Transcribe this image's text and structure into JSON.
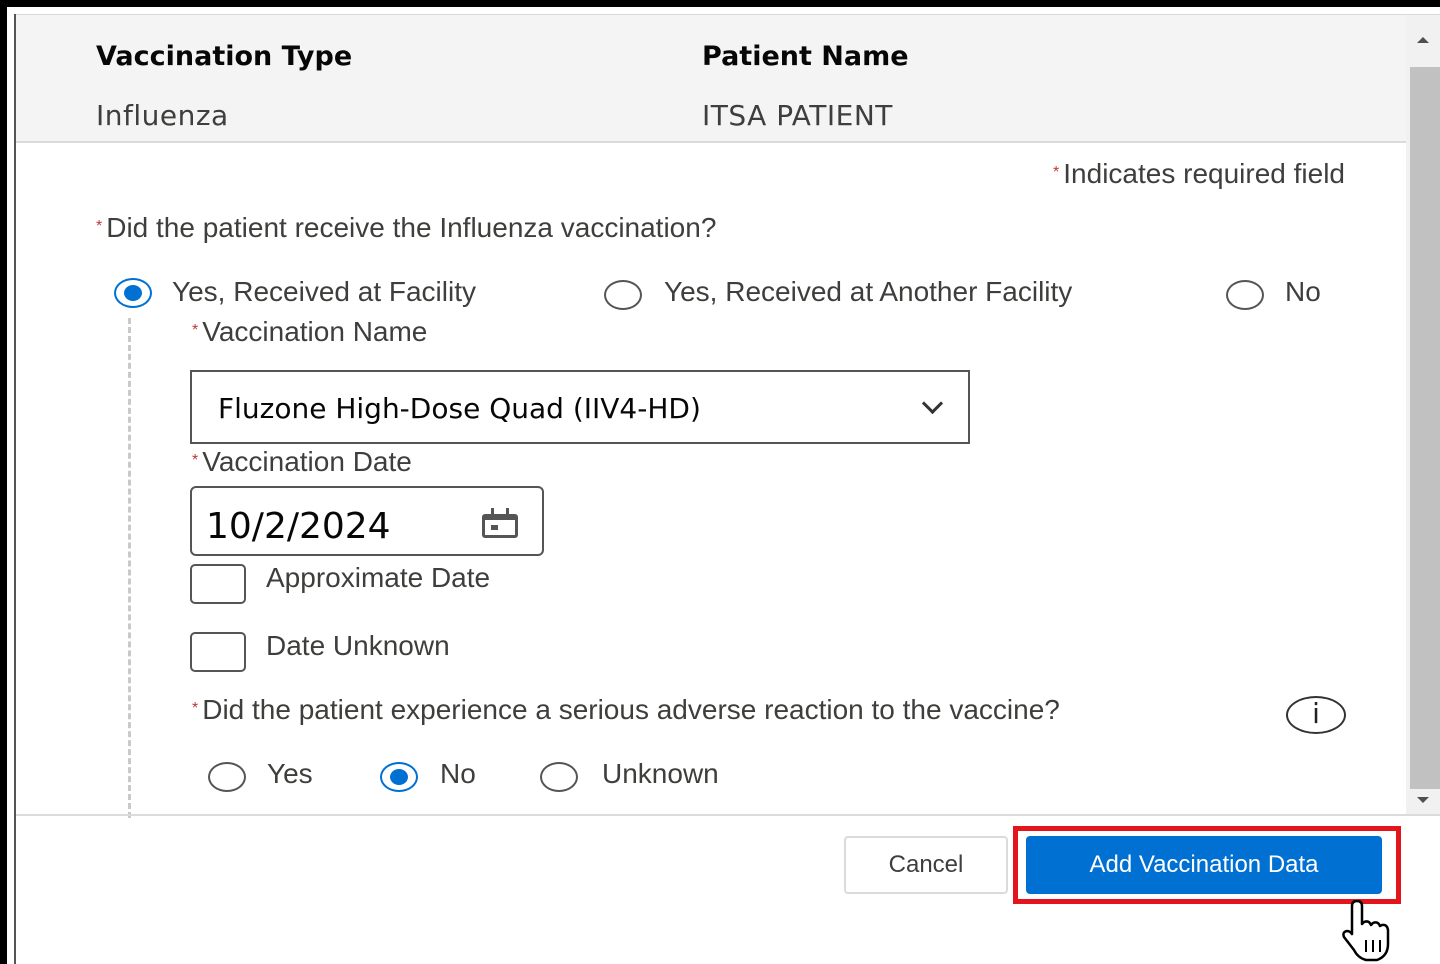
{
  "header": {
    "vaccination_type_label": "Vaccination Type",
    "vaccination_type_value": "Influenza",
    "patient_name_label": "Patient Name",
    "patient_name_value": "ITSA PATIENT"
  },
  "required_marker": "*",
  "required_note": "Indicates required field",
  "received_question": "Did the patient receive the Influenza vaccination?",
  "received_options": [
    {
      "label": "Yes, Received at Facility",
      "selected": true
    },
    {
      "label": "Yes, Received at Another Facility",
      "selected": false
    },
    {
      "label": "No",
      "selected": false
    }
  ],
  "vaccination_name": {
    "label": "Vaccination Name",
    "value": "Fluzone High-Dose Quad (IIV4-HD)"
  },
  "vaccination_date": {
    "label": "Vaccination Date",
    "value": "10/2/2024",
    "approximate_label": "Approximate Date",
    "approximate_checked": false,
    "unknown_label": "Date Unknown",
    "unknown_checked": false
  },
  "reaction_question": "Did the patient experience a serious adverse reaction to the vaccine?",
  "info_icon_glyph": "i",
  "reaction_options": [
    {
      "label": "Yes",
      "selected": false
    },
    {
      "label": "No",
      "selected": true
    },
    {
      "label": "Unknown",
      "selected": false
    }
  ],
  "footer": {
    "cancel_label": "Cancel",
    "submit_label": "Add Vaccination Data"
  },
  "colors": {
    "primary": "#0070d2",
    "required": "#c23934",
    "highlight": "#e2151c"
  },
  "icons": [
    "calendar-icon",
    "chevron-down-icon",
    "info-icon",
    "hand-pointer-cursor"
  ]
}
